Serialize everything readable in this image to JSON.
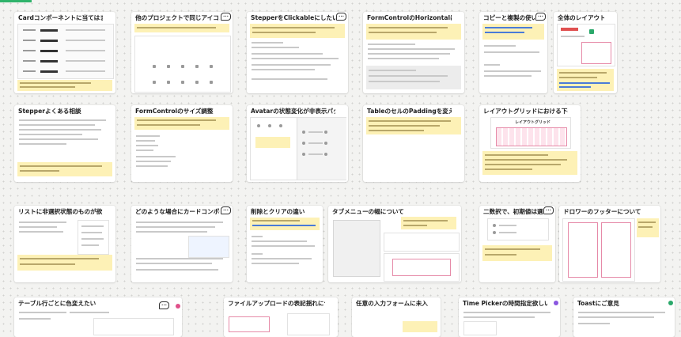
{
  "cards": {
    "r1c1": {
      "title": "Cardコンポーネントに当てはまらない場合..."
    },
    "r1c2": {
      "title": "他のプロジェクトで同じアイコンが使われてこ..."
    },
    "r1c3": {
      "title": "StepperをClickableにしたい"
    },
    "r1c4": {
      "title": "FormControlのHorizontalは使用NG？"
    },
    "r1c5": {
      "title": "コピーと複製の使い分け"
    },
    "r1c6": {
      "title": "全体のレイアウトの確認"
    },
    "r2c1": {
      "title": "Stepperよくある相談"
    },
    "r2c2": {
      "title": "FormControlのサイズ調整"
    },
    "r2c3": {
      "title": "Avatarの状態変化が非表示パターンを追加..."
    },
    "r2c4": {
      "title": "TableのセルのPaddingを変えても良い？"
    },
    "r2c5": {
      "title": "レイアウトグリッドにおける下の余白を32p..."
    },
    "r3c1": {
      "title": "リストに非選択状態のものが欲しい"
    },
    "r3c2": {
      "title": "どのような場合にカードコンポーネントを..."
    },
    "r3c3": {
      "title": "削除とクリアの違い"
    },
    "r3c4": {
      "title": "タブメニューの幅について"
    },
    "r3c5": {
      "title": "二数択で、初期値は選ばれていな..."
    },
    "r3c6": {
      "title": "ドロワーのフッターについて"
    },
    "r4c1": {
      "title": "テーブル行ごとに色変えたい"
    },
    "r4c2": {
      "title": "ファイルアップロードの表記揺れについて"
    },
    "r4c3": {
      "title": "任意の入力フォームに未入力の場合..."
    },
    "r4c4": {
      "title": "Time Pickerの時間指定欲しい"
    },
    "r4c5": {
      "title": "Toastにご意見"
    }
  },
  "inner_labels": {
    "grid_heading": "レイアウトグリッド"
  },
  "colors": {
    "accent_green": "#2fb36b",
    "sticky_yellow": "#fdf1b6",
    "dot_green": "#2aa86a",
    "dot_purple": "#8a56e0",
    "dot_pink": "#e0508a",
    "link_blue": "#2c5cc5"
  },
  "icons": {
    "comment": "comment-bubble-icon",
    "status_dot": "status-dot-icon"
  }
}
